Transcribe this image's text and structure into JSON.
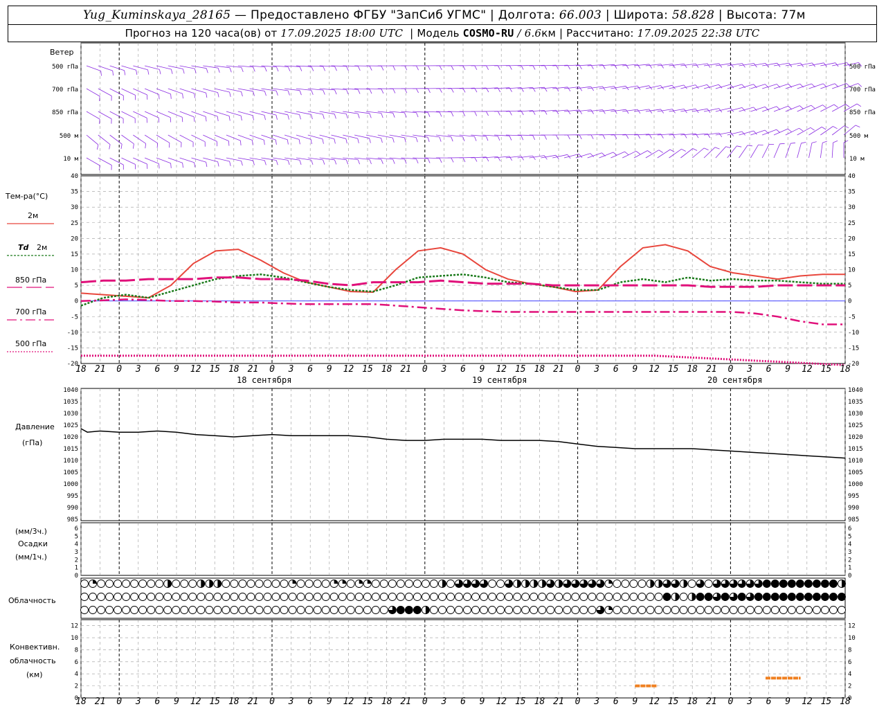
{
  "header": {
    "station": "Yug_Kuminskaya_28165",
    "provider": "— Предоставлено ФГБУ \"ЗапСиб УГМС\"",
    "lon_label": "Долгота:",
    "lon": "66.003",
    "lat_label": "Широта:",
    "lat": "58.828",
    "alt_label": "Высота:",
    "alt": "77м",
    "forecast_prefix": "Прогноз на 120 часа(ов) от",
    "forecast_time": "17.09.2025 18:00 UTC",
    "model_label": "Модель",
    "model": "COSMO-RU",
    "resolution": "/ 6.6",
    "resolution_unit": "км",
    "calc_label": "Рассчитано:",
    "calc_time": "17.09.2025 22:38 UTC",
    "sep": "|"
  },
  "colors": {
    "wind": "#8a2be2",
    "t2m": "#e8463c",
    "td2m": "#1a7a1a",
    "t850": "#e0107a",
    "t700": "#e0107a",
    "t500": "#e0107a",
    "pressure": "#000000",
    "grid": "#999999",
    "zero_line": "#4040ff",
    "convective": "#f08020"
  },
  "labels": {
    "wind": "Ветер",
    "wind_levels": [
      "500 гПа",
      "700 гПа",
      "850 гПа",
      "500 м",
      "10  м"
    ],
    "temp_title": "Тем-ра(°С)",
    "legend_2m": "2м",
    "legend_td": "Td",
    "legend_td_2m": "2м",
    "legend_850": "850 гПа",
    "legend_700": "700 гПа",
    "legend_500": "500 гПа",
    "pressure_title": "Давление",
    "pressure_unit": "(гПа)",
    "precip_unit_3h": "(мм/3ч.)",
    "precip_title": "Осадки",
    "precip_unit_1h": "(мм/1ч.)",
    "cloud_title": "Облачность",
    "conv_title_1": "Конвективн.",
    "conv_title_2": "облачность",
    "conv_unit": "(км)",
    "dates": [
      "18 сентября",
      "19 сентября",
      "20 сентября"
    ]
  },
  "chart_data": [
    {
      "type": "line",
      "name": "temperature",
      "x_hours": [
        0,
        3,
        6,
        9,
        12,
        15,
        18,
        21,
        24,
        27,
        30,
        33,
        36,
        39,
        42,
        45,
        48,
        51,
        54,
        57,
        60,
        63,
        66,
        69,
        72,
        75,
        78,
        81,
        84,
        87,
        90,
        93,
        96,
        99,
        102,
        105,
        108,
        111,
        114,
        117,
        120
      ],
      "x_tick_labels": [
        "18",
        "21",
        "0",
        "3",
        "6",
        "9",
        "12",
        "15",
        "18",
        "21",
        "0",
        "3",
        "6",
        "9",
        "12",
        "15",
        "18",
        "21",
        "0",
        "3",
        "6",
        "9",
        "12",
        "15",
        "18",
        "21",
        "0",
        "3",
        "6",
        "9",
        "12",
        "15",
        "18",
        "21",
        "0",
        "3",
        "6",
        "9",
        "12",
        "15",
        "18",
        "21",
        "0"
      ],
      "ylim": [
        -20,
        40
      ],
      "yticks": [
        40,
        35,
        30,
        25,
        20,
        15,
        10,
        5,
        0,
        -5,
        -10,
        -15,
        -20
      ],
      "grid": true,
      "series": [
        {
          "name": "2м",
          "style": "solid",
          "values": [
            2.5,
            2,
            1.5,
            1,
            5,
            12,
            16,
            16.5,
            13,
            9,
            6,
            4.5,
            3,
            2.8,
            10,
            16,
            17,
            15,
            10,
            7,
            5.5,
            4.5,
            3,
            3.5,
            11,
            17,
            18,
            16,
            11,
            9,
            8,
            7,
            8,
            8.5,
            8.5
          ]
        },
        {
          "name": "Td 2м",
          "style": "dotted",
          "values": [
            -1.5,
            1,
            2,
            1,
            3,
            5,
            7,
            8,
            8.5,
            7.5,
            6,
            4.5,
            3.5,
            3,
            5,
            7.5,
            8,
            8.5,
            7.5,
            6,
            5.5,
            4.5,
            3.5,
            3.5,
            6,
            7,
            6,
            7.5,
            6.5,
            7,
            6.5,
            6.5,
            6,
            5.5,
            5.5
          ]
        },
        {
          "name": "850 гПа",
          "style": "long-dash",
          "values": [
            6,
            6.5,
            6.5,
            7,
            7,
            7,
            7.5,
            7.5,
            7,
            7,
            6.5,
            5.5,
            5,
            6,
            6,
            6,
            6.5,
            6,
            5.5,
            5.5,
            5.5,
            5,
            5,
            5,
            5,
            5,
            5,
            5,
            4.5,
            4.5,
            4.5,
            5,
            5,
            5,
            5
          ]
        },
        {
          "name": "700 гПа",
          "style": "dash-dot",
          "values": [
            0,
            0.2,
            0.5,
            0.3,
            0,
            0,
            -0.2,
            -0.5,
            -0.5,
            -0.8,
            -1,
            -1,
            -1,
            -1,
            -1.5,
            -2,
            -2.5,
            -3,
            -3.3,
            -3.5,
            -3.5,
            -3.5,
            -3.5,
            -3.5,
            -3.5,
            -3.5,
            -3.5,
            -3.5,
            -3.5,
            -3.5,
            -4,
            -5,
            -6.5,
            -7.5,
            -7.5
          ]
        },
        {
          "name": "500 гПа",
          "style": "fine-dotted",
          "values": [
            -17.5,
            -17.5,
            -17.5,
            -17.5,
            -17.5,
            -17.5,
            -17.5,
            -17.5,
            -17.5,
            -17.5,
            -17.5,
            -17.5,
            -17.5,
            -17.5,
            -17.5,
            -17.5,
            -17.5,
            -17.5,
            -17.5,
            -18,
            -18.5,
            -19,
            -19.5,
            -20,
            -20.5
          ]
        }
      ]
    },
    {
      "type": "line",
      "name": "pressure",
      "ylim": [
        985,
        1040
      ],
      "yticks": [
        1040,
        1035,
        1030,
        1025,
        1020,
        1015,
        1010,
        1005,
        1000,
        995,
        990,
        985
      ],
      "grid": true,
      "series": [
        {
          "name": "Давление",
          "style": "solid",
          "x_hours": [
            0,
            1,
            3,
            6,
            9,
            12,
            15,
            18,
            21,
            24,
            27,
            30,
            33,
            36,
            39,
            42,
            45,
            48,
            51,
            54,
            57,
            60,
            63,
            66,
            69,
            72,
            75,
            78,
            81,
            84,
            87,
            90,
            93,
            96,
            99,
            102,
            105,
            108,
            111,
            114,
            117,
            120
          ],
          "values": [
            1023.5,
            1022,
            1022.5,
            1022,
            1022,
            1022.5,
            1022,
            1021,
            1020.5,
            1020,
            1020.5,
            1021,
            1020.5,
            1020.5,
            1020.5,
            1020.5,
            1020,
            1019,
            1018.5,
            1018.5,
            1019,
            1019,
            1019,
            1018.5,
            1018.5,
            1018.5,
            1018,
            1017,
            1016,
            1015.5,
            1015,
            1015,
            1015,
            1015,
            1014.5,
            1014,
            1013.5,
            1013,
            1012.5,
            1012,
            1011.5,
            1011
          ]
        }
      ]
    },
    {
      "type": "bar",
      "name": "precipitation",
      "ylim": [
        0,
        6
      ],
      "yticks": [
        6,
        5,
        4,
        3,
        2,
        1,
        0
      ],
      "values": []
    },
    {
      "type": "table",
      "name": "cloudiness",
      "note": "cloud cover octa-fraction per 2h step, rows: upper, middle, lower",
      "rows": [
        [
          0,
          0.25,
          0,
          0,
          0,
          0,
          0,
          0,
          0,
          0,
          0.5,
          0,
          0,
          0,
          0.5,
          0.5,
          0.5,
          0,
          0,
          0,
          0,
          0,
          0,
          0,
          0,
          0.25,
          0,
          0,
          0,
          0,
          0.25,
          0.25,
          0,
          0.25,
          0.25,
          0,
          0,
          0,
          0,
          0,
          0,
          0,
          0,
          0.5,
          0,
          0.75,
          0.75,
          0.75,
          0.75,
          0,
          0,
          0.75,
          0.5,
          0.5,
          0.5,
          0.5,
          0.75,
          0.5,
          0.75,
          0.75,
          0.75,
          0.75,
          0.75,
          0.25,
          0,
          0,
          0,
          0,
          0.5,
          0.5,
          0.75,
          0.75,
          0.5,
          0,
          0.75,
          0,
          0.75,
          0.75,
          0.75,
          0.75,
          0.75,
          0.75,
          1,
          1,
          1,
          1,
          1,
          1,
          1,
          1,
          1,
          0.5
        ],
        [
          0,
          0,
          0,
          0,
          0,
          0,
          0,
          0,
          0,
          0,
          0,
          0,
          0,
          0,
          0,
          0,
          0,
          0,
          0,
          0,
          0,
          0,
          0,
          0,
          0,
          0,
          0,
          0,
          0,
          0,
          0,
          0,
          0,
          0,
          0,
          0,
          0,
          0,
          0,
          0,
          0,
          0,
          0,
          0,
          0,
          0,
          0,
          0,
          0,
          0,
          0,
          0,
          0,
          0,
          0,
          0,
          0,
          0,
          0,
          0,
          0,
          0,
          0,
          0,
          0,
          0,
          0,
          0,
          0,
          0,
          1,
          0.5,
          0,
          0.5,
          1,
          1,
          0.75,
          1,
          0.75,
          1,
          0.75,
          1,
          1,
          1,
          1,
          1,
          1,
          1,
          1,
          1,
          1,
          1
        ],
        [
          0,
          0,
          0,
          0,
          0,
          0,
          0,
          0,
          0,
          0,
          0,
          0,
          0,
          0,
          0,
          0,
          0,
          0,
          0,
          0,
          0,
          0,
          0,
          0,
          0,
          0,
          0,
          0,
          0,
          0,
          0,
          0,
          0,
          0,
          0,
          0,
          0,
          0.75,
          1,
          1,
          1,
          0.5,
          0,
          0,
          0,
          0,
          0,
          0,
          0,
          0,
          0,
          0,
          0,
          0,
          0,
          0,
          0,
          0,
          0,
          0,
          0,
          0,
          0.75,
          0.25,
          0,
          0,
          0,
          0,
          0,
          0,
          0,
          0,
          0,
          0,
          0,
          0,
          0,
          0,
          0,
          0,
          0,
          0,
          0,
          0,
          0,
          0,
          0,
          0,
          0,
          0,
          0,
          0
        ]
      ]
    },
    {
      "type": "bar",
      "name": "convective_cloud",
      "ylim": [
        0,
        13
      ],
      "yticks": [
        12,
        10,
        8,
        6,
        4,
        2,
        0
      ],
      "segments": [
        {
          "x_hours_from": 87,
          "x_hours_to": 90.5,
          "top_km": 2
        },
        {
          "x_hours_from": 107.5,
          "x_hours_to": 113,
          "top_km": 3.3
        }
      ]
    },
    {
      "type": "wind_barbs",
      "name": "wind",
      "levels": [
        "500 гПа",
        "700 гПа",
        "850 гПа",
        "500 м",
        "10  м"
      ]
    }
  ]
}
